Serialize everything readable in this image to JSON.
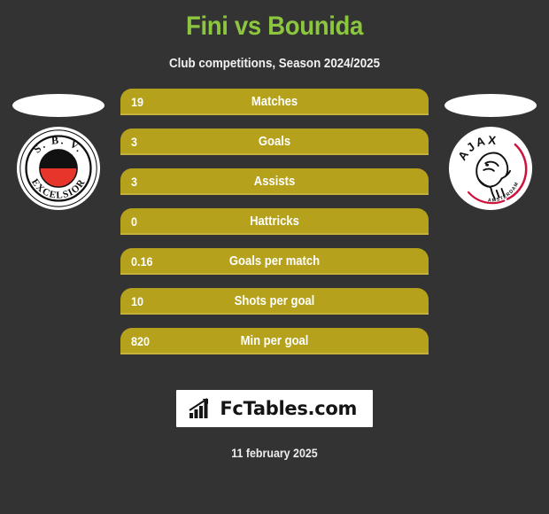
{
  "header": {
    "title": "Fini vs Bounida",
    "subtitle": "Club competitions, Season 2024/2025",
    "title_color": "#8CC63F",
    "subtitle_color": "#F2F2F2"
  },
  "theme": {
    "background": "#333333",
    "bar_color": "#B5A11C",
    "bar_text_color": "#FFFFFF",
    "accent_green": "#8CC63F"
  },
  "clubs": {
    "left": {
      "name": "S.B.V. Excelsior",
      "crest_icon": "excelsior-crest-icon",
      "text_top": "S. B. V.",
      "text_bottom": "EXCELSIOR",
      "colors": [
        "#000000",
        "#E8352B",
        "#FFFFFF"
      ]
    },
    "right": {
      "name": "Ajax Amsterdam",
      "crest_icon": "ajax-crest-icon",
      "text_top": "AJAX",
      "text_bottom": "AMSTERDAM",
      "colors": [
        "#D0103A",
        "#FFFFFF",
        "#111111"
      ]
    }
  },
  "stats": [
    {
      "label": "Matches",
      "value": "19"
    },
    {
      "label": "Goals",
      "value": "3"
    },
    {
      "label": "Assists",
      "value": "3"
    },
    {
      "label": "Hattricks",
      "value": "0"
    },
    {
      "label": "Goals per match",
      "value": "0.16"
    },
    {
      "label": "Shots per goal",
      "value": "10"
    },
    {
      "label": "Min per goal",
      "value": "820"
    }
  ],
  "footer": {
    "logo_text": "FcTables.com",
    "logo_icon": "bar-chart-icon",
    "date": "11 february 2025"
  }
}
